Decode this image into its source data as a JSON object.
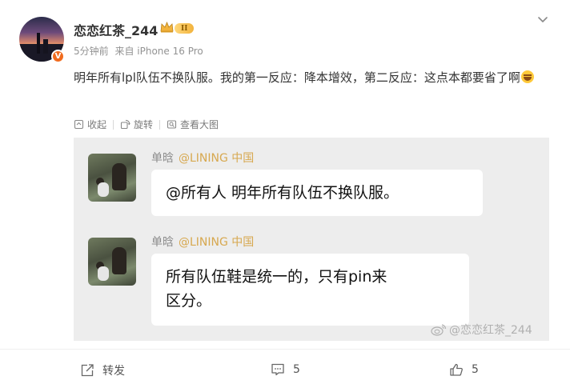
{
  "post": {
    "username": "恋恋红茶_244",
    "level_badge": "II",
    "verified_mark": "V",
    "time": "5分钟前",
    "source": "来自 iPhone 16 Pro",
    "text": "明年所有lpl队伍不换队服。我的第一反应：降本增效，第二反应：这点本都要省了啊",
    "emoji": "laughing-tears-emoji"
  },
  "toolbar": {
    "collect_label": "收起",
    "rotate_label": "旋转",
    "view_large_label": "查看大图"
  },
  "image": {
    "messages": [
      {
        "sender": "单晗",
        "mention": "@LINING 中国",
        "text": "@所有人  明年所有队伍不换队服。"
      },
      {
        "sender": "单晗",
        "mention": "@LINING 中国",
        "text_line1": "所有队伍鞋是统一的，只有pin来",
        "text_line2": "区分。"
      }
    ],
    "watermark": "@恋恋红茶_244"
  },
  "footer": {
    "repost_label": "转发",
    "comment_count": "5",
    "like_count": "5"
  },
  "colors": {
    "accent_orange": "#f06b1e",
    "mention_gold": "#d7a84f",
    "panel_bg": "#ededed"
  }
}
